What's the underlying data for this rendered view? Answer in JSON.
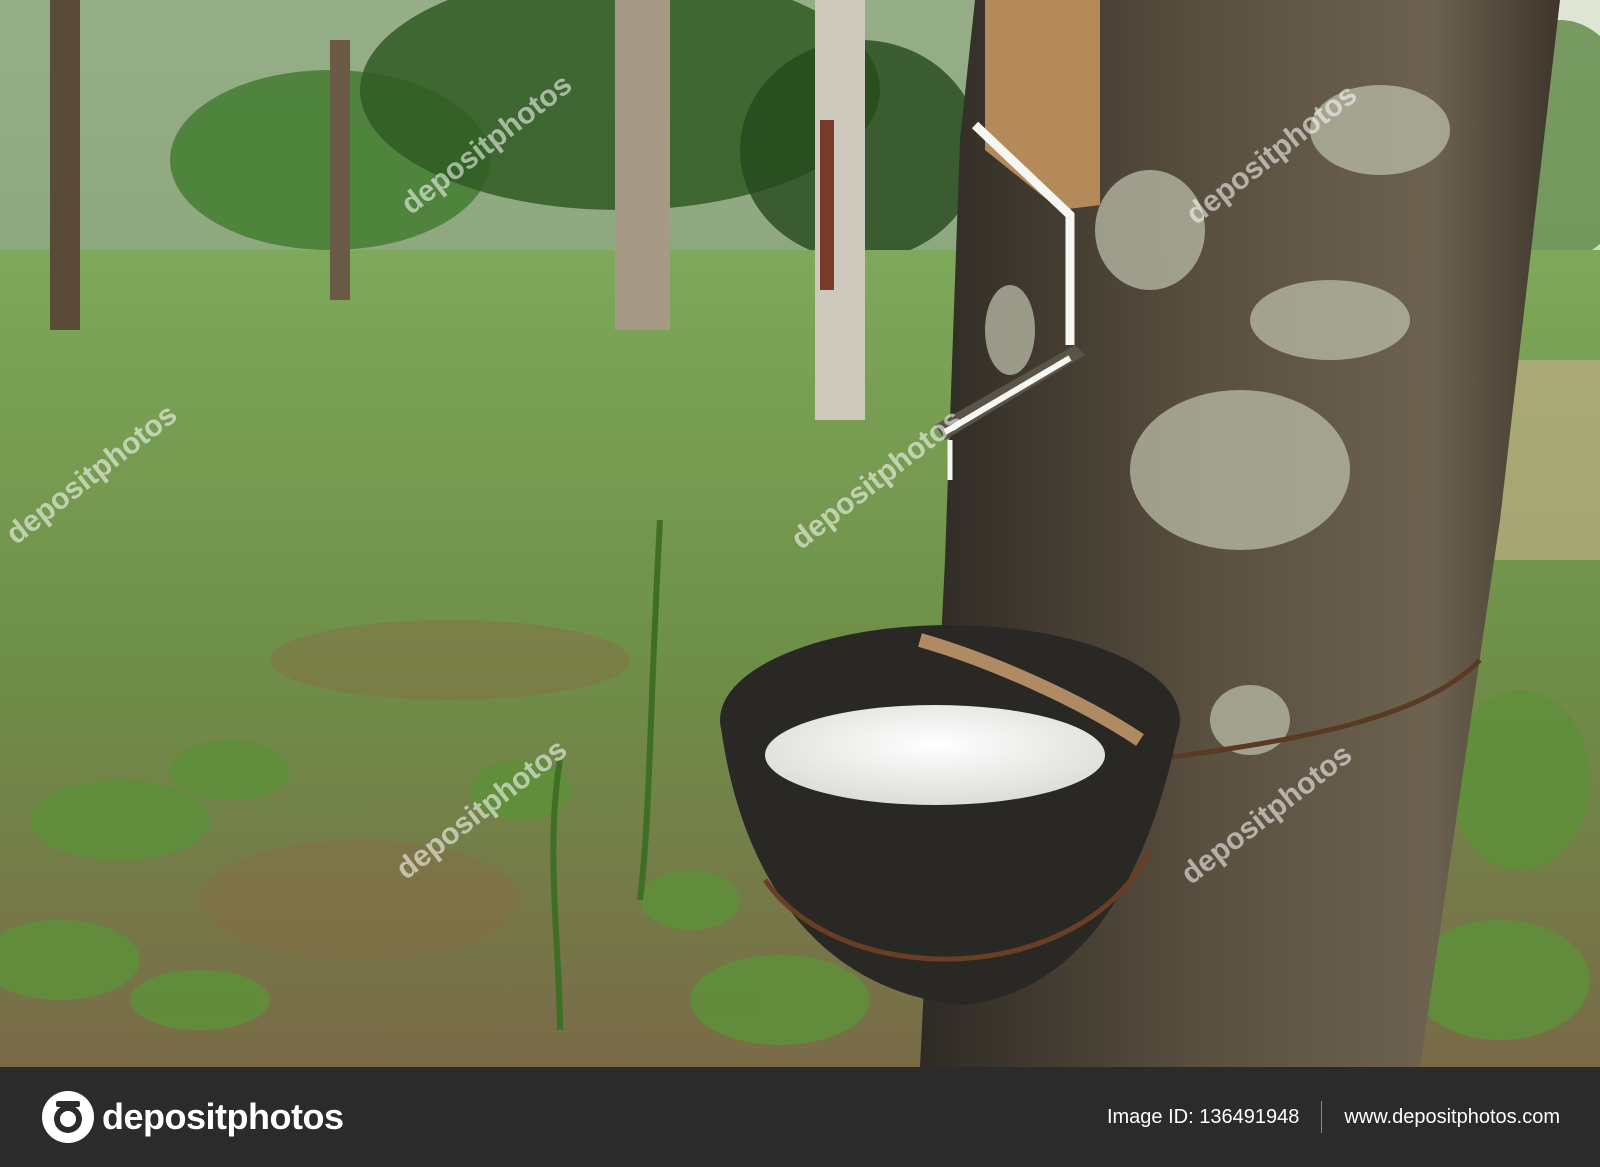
{
  "photo": {
    "subject": "rubber-tree-latex-tapping",
    "watermark_text": "depositphotos",
    "colors": {
      "foliage": "#4f7a2e",
      "bark": "#4a3f32",
      "latex": "#f2f2ef",
      "cup": "#2a2824",
      "soil": "#8a6a48"
    }
  },
  "footer": {
    "logo_text": "depositphotos",
    "image_id_label": "Image ID: 136491948",
    "website": "www.depositphotos.com",
    "background_color": "#2b2b2b"
  }
}
